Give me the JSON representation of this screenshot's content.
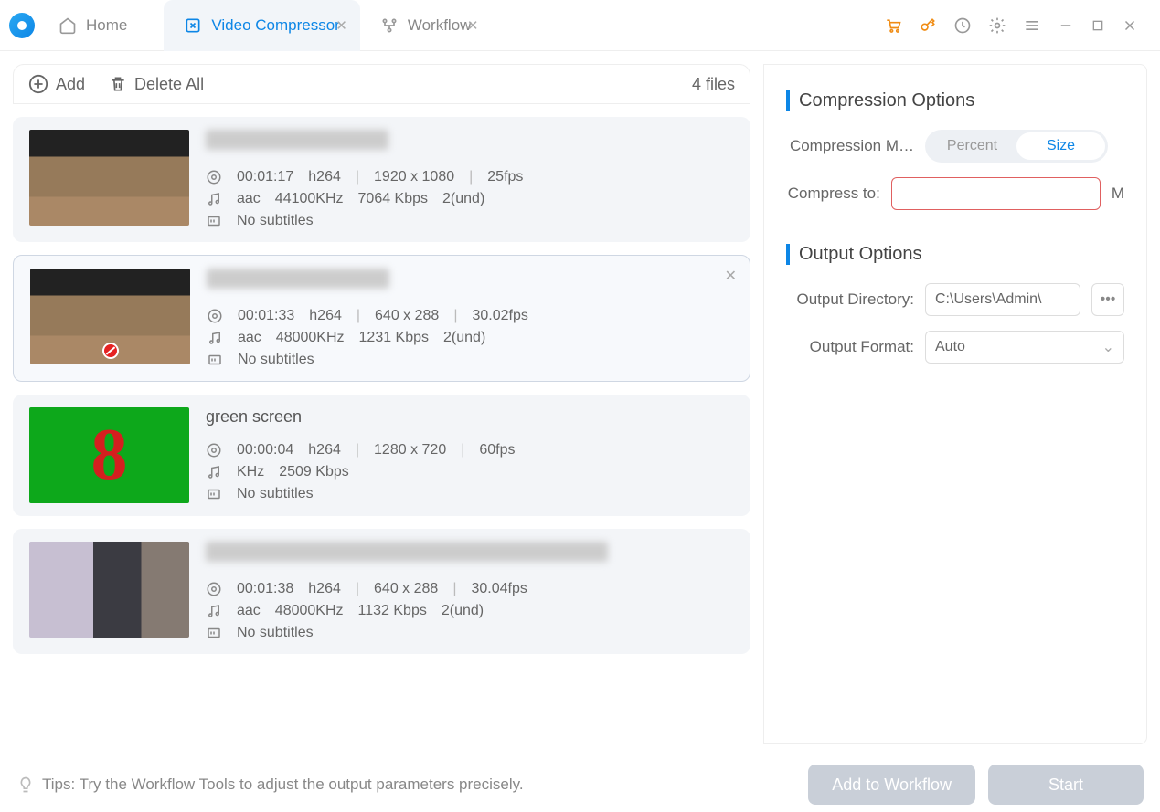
{
  "tabs": {
    "home": "Home",
    "compressor": "Video Compressor",
    "workflow": "Workflow"
  },
  "toolbar": {
    "add": "Add",
    "delete_all": "Delete All",
    "file_count": "4 files"
  },
  "files": [
    {
      "duration": "00:01:17",
      "vcodec": "h264",
      "res": "1920  x  1080",
      "fps": "25fps",
      "acodec": "aac",
      "rate": "44100KHz",
      "bitrate": "7064 Kbps",
      "ch": "2(und)",
      "subs": "No subtitles"
    },
    {
      "duration": "00:01:33",
      "vcodec": "h264",
      "res": "640  x  288",
      "fps": "30.02fps",
      "acodec": "aac",
      "rate": "48000KHz",
      "bitrate": "1231 Kbps",
      "ch": "2(und)",
      "subs": "No subtitles"
    },
    {
      "title": "green screen",
      "duration": "00:00:04",
      "vcodec": "h264",
      "res": "1280  x  720",
      "fps": "60fps",
      "acodec": "",
      "rate": "KHz",
      "bitrate": "2509 Kbps",
      "ch": "",
      "subs": "No subtitles"
    },
    {
      "duration": "00:01:38",
      "vcodec": "h264",
      "res": "640  x  288",
      "fps": "30.04fps",
      "acodec": "aac",
      "rate": "48000KHz",
      "bitrate": "1132 Kbps",
      "ch": "2(und)",
      "subs": "No subtitles"
    }
  ],
  "opts": {
    "compression_title": "Compression Options",
    "mode_label": "Compression M…",
    "mode_percent": "Percent",
    "mode_size": "Size",
    "compress_to_label": "Compress to:",
    "compress_to_value": "",
    "unit": "M",
    "output_title": "Output Options",
    "outdir_label": "Output Directory:",
    "outdir_value": "C:\\Users\\Admin\\",
    "outfmt_label": "Output Format:",
    "outfmt_value": "Auto"
  },
  "footer": {
    "tip": "Tips: Try the Workflow Tools to adjust the output parameters precisely.",
    "add_wf": "Add to Workflow",
    "start": "Start"
  }
}
